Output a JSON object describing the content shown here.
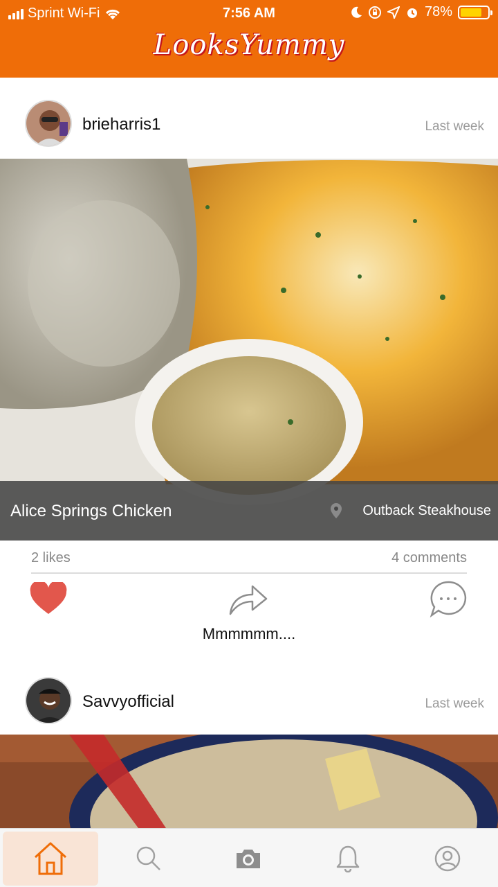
{
  "status_bar": {
    "carrier": "Sprint Wi-Fi",
    "time": "7:56 AM",
    "battery": "78%",
    "battery_level": 0.78
  },
  "app": {
    "title": "LooksYummy"
  },
  "posts": [
    {
      "username": "brieharris1",
      "time": "Last week",
      "dish": "Alice Springs Chicken",
      "restaurant": "Outback Steakhouse",
      "likes": "2 likes",
      "comments": "4 comments",
      "caption": "Mmmmmm...."
    },
    {
      "username": "Savvyofficial",
      "time": "Last week"
    }
  ],
  "tabbar": {
    "items": [
      "home-icon",
      "search-icon",
      "camera-icon",
      "bell-icon",
      "profile-icon"
    ],
    "active": "home-icon"
  },
  "colors": {
    "brand": "#ef6d08",
    "like": "#e2574c",
    "overlay": "#464646"
  }
}
